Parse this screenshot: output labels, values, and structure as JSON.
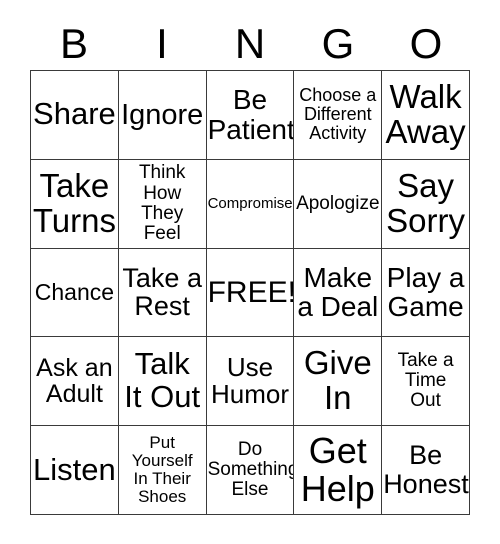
{
  "card": {
    "header_letters": [
      "B",
      "I",
      "N",
      "G",
      "O"
    ],
    "free_space_label": "FREE!",
    "colors": {
      "background": "#ffffff",
      "border": "#3a3a3a",
      "text": "#000000"
    },
    "rows": [
      [
        {
          "label": "Share",
          "size": "fs-31"
        },
        {
          "label": "Ignore",
          "size": "fs-29"
        },
        {
          "label": "Be\nPatient",
          "size": "fs-28"
        },
        {
          "label": "Choose a\nDifferent\nActivity",
          "size": "fs-18"
        },
        {
          "label": "Walk\nAway",
          "size": "fs-33"
        }
      ],
      [
        {
          "label": "Take\nTurns",
          "size": "fs-33"
        },
        {
          "label": "Think\nHow They\nFeel",
          "size": "fs-19"
        },
        {
          "label": "Compromise",
          "size": "fs-15"
        },
        {
          "label": "Apologize",
          "size": "fs-19"
        },
        {
          "label": "Say\nSorry",
          "size": "fs-33"
        }
      ],
      [
        {
          "label": "Chance",
          "size": "fs-23"
        },
        {
          "label": "Take a\nRest",
          "size": "fs-27"
        },
        {
          "label": "FREE!",
          "size": "fs-30"
        },
        {
          "label": "Make\na Deal",
          "size": "fs-28"
        },
        {
          "label": "Play a\nGame",
          "size": "fs-28"
        }
      ],
      [
        {
          "label": "Ask an\nAdult",
          "size": "fs-25"
        },
        {
          "label": "Talk\nIt Out",
          "size": "fs-31"
        },
        {
          "label": "Use\nHumor",
          "size": "fs-26"
        },
        {
          "label": "Give\nIn",
          "size": "fs-33"
        },
        {
          "label": "Take a\nTime\nOut",
          "size": "fs-19"
        }
      ],
      [
        {
          "label": "Listen",
          "size": "fs-31"
        },
        {
          "label": "Put\nYourself\nIn Their\nShoes",
          "size": "fs-17"
        },
        {
          "label": "Do\nSomething\nElse",
          "size": "fs-19"
        },
        {
          "label": "Get\nHelp",
          "size": "fs-36"
        },
        {
          "label": "Be\nHonest",
          "size": "fs-27"
        }
      ]
    ]
  }
}
